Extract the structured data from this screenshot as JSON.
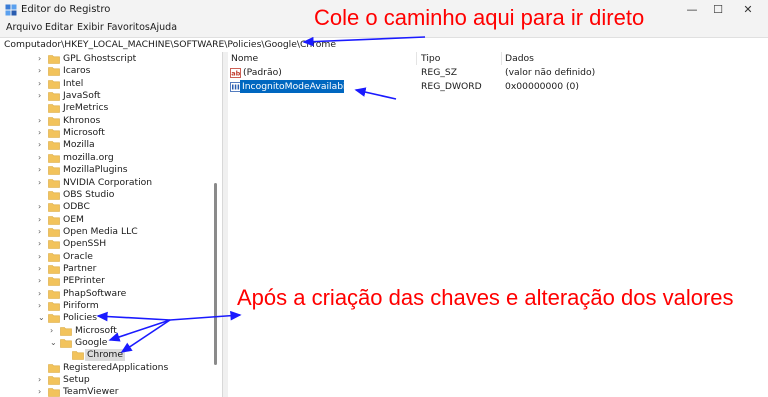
{
  "window": {
    "title": "Editor do Registro",
    "controls": {
      "minimize": "—",
      "maximize": "☐",
      "close": "✕"
    }
  },
  "menu": [
    "Arquivo",
    "Editar",
    "Exibir",
    "Favoritos",
    "Ajuda"
  ],
  "address_bar": {
    "path": "Computador\\HKEY_LOCAL_MACHINE\\SOFTWARE\\Policies\\Google\\Chrome"
  },
  "tree": {
    "items": [
      {
        "label": "GPL Ghostscript",
        "expand": "›"
      },
      {
        "label": "Icaros",
        "expand": "›"
      },
      {
        "label": "Intel",
        "expand": "›"
      },
      {
        "label": "JavaSoft",
        "expand": "›"
      },
      {
        "label": "JreMetrics",
        "expand": ""
      },
      {
        "label": "Khronos",
        "expand": "›"
      },
      {
        "label": "Microsoft",
        "expand": "›"
      },
      {
        "label": "Mozilla",
        "expand": "›"
      },
      {
        "label": "mozilla.org",
        "expand": "›"
      },
      {
        "label": "MozillaPlugins",
        "expand": "›"
      },
      {
        "label": "NVIDIA Corporation",
        "expand": "›"
      },
      {
        "label": "OBS Studio",
        "expand": ""
      },
      {
        "label": "ODBC",
        "expand": "›"
      },
      {
        "label": "OEM",
        "expand": "›"
      },
      {
        "label": "Open Media LLC",
        "expand": "›"
      },
      {
        "label": "OpenSSH",
        "expand": "›"
      },
      {
        "label": "Oracle",
        "expand": "›"
      },
      {
        "label": "Partner",
        "expand": "›"
      },
      {
        "label": "PEPrinter",
        "expand": "›"
      },
      {
        "label": "PhapSoftware",
        "expand": "›"
      },
      {
        "label": "Piriform",
        "expand": "›"
      },
      {
        "label": "Policies",
        "expand": "⌄"
      },
      {
        "label": "Microsoft",
        "expand": "›"
      },
      {
        "label": "Google",
        "expand": "⌄"
      },
      {
        "label": "Chrome",
        "expand": ""
      },
      {
        "label": "RegisteredApplications",
        "expand": ""
      },
      {
        "label": "Setup",
        "expand": "›"
      },
      {
        "label": "TeamViewer",
        "expand": "›"
      }
    ]
  },
  "columns": {
    "name": "Nome",
    "type": "Tipo",
    "data": "Dados"
  },
  "values": [
    {
      "name": "(Padrão)",
      "type": "REG_SZ",
      "data": "(valor não definido)",
      "icon": "ab-string-icon"
    },
    {
      "name": "IncognitoModeAvailability",
      "type": "REG_DWORD",
      "data": "0x00000000 (0)",
      "icon": "binary-dword-icon"
    }
  ],
  "annotations": {
    "top": "Cole o caminho aqui para ir direto",
    "middle": "Após a criação das chaves e alteração dos valores"
  },
  "colors": {
    "annotation": "#ff0000",
    "arrow": "#1a1aff",
    "selection": "#0067c0",
    "folder": "#f2c35c"
  }
}
